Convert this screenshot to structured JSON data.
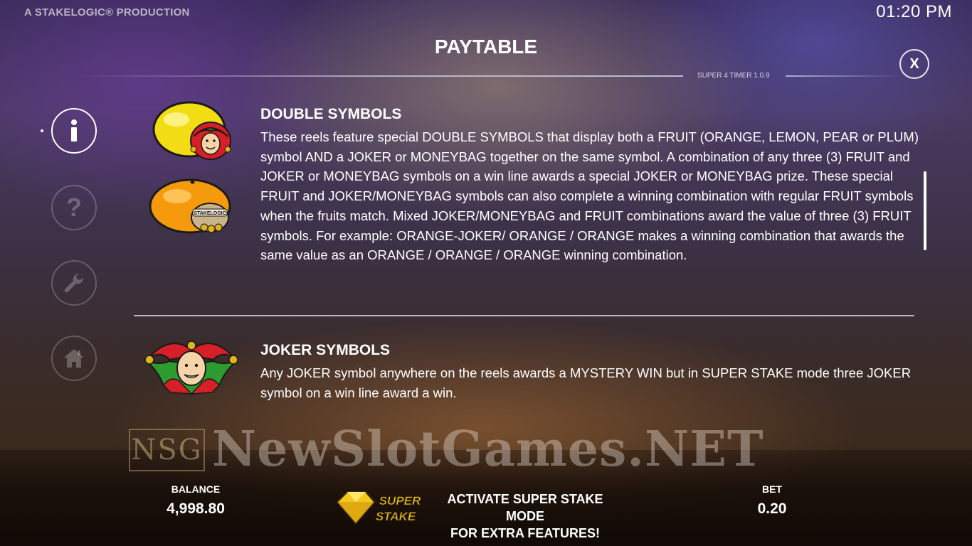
{
  "header": {
    "brand": "A STAKELOGIC® PRODUCTION",
    "clock": "01:20 PM",
    "title": "PAYTABLE",
    "version": "SUPER 4 TIMER 1.0.9",
    "close_label": "X"
  },
  "side_nav": {
    "items": [
      {
        "label": "i",
        "icon": "info-icon",
        "active": true
      },
      {
        "label": "?",
        "icon": "help-icon",
        "active": false
      },
      {
        "label": "",
        "icon": "wrench-icon",
        "active": false
      },
      {
        "label": "",
        "icon": "home-icon",
        "active": false
      }
    ]
  },
  "sections": [
    {
      "title": "DOUBLE SYMBOLS",
      "text": "These reels feature special DOUBLE SYMBOLS that display both a FRUIT (ORANGE, LEMON, PEAR or PLUM) symbol AND a JOKER or MONEYBAG together on the same symbol. A combination of any three (3) FRUIT and JOKER or MONEYBAG symbols on a win line awards a special JOKER or MONEYBAG prize. These special FRUIT and JOKER/MONEYBAG symbols can also complete a winning combination with regular FRUIT symbols when the fruits match. Mixed JOKER/MONEYBAG and FRUIT combinations award the value of three (3) FRUIT symbols. For example: ORANGE-JOKER/ ORANGE / ORANGE makes a winning combination that awards the same value as an ORANGE / ORANGE / ORANGE winning combination.",
      "symbols": [
        "lemon-joker-symbol",
        "orange-moneybag-symbol"
      ],
      "moneybag_label": "STAKELOGIC"
    },
    {
      "title": "JOKER SYMBOLS",
      "text": "Any JOKER symbol anywhere on the reels awards a MYSTERY WIN but in SUPER STAKE mode three JOKER symbol on a win line award a win.",
      "symbols": [
        "joker-symbol"
      ]
    }
  ],
  "watermark": {
    "logo": "NSG",
    "text": "NewSlotGames.NET"
  },
  "footer": {
    "balance_label": "BALANCE",
    "balance_value": "4,998.80",
    "promo_line1": "ACTIVATE SUPER STAKE MODE",
    "promo_line2": "FOR EXTRA FEATURES!",
    "super_stake_logo": "SUPER STAKE",
    "bet_label": "BET",
    "bet_value": "0.20"
  },
  "colors": {
    "text": "#ffffff",
    "lemon": "#f2dc14",
    "orange": "#f59a0c",
    "joker_red": "#d61f26",
    "joker_green": "#2d9b2f",
    "gold": "#e2b21a"
  }
}
